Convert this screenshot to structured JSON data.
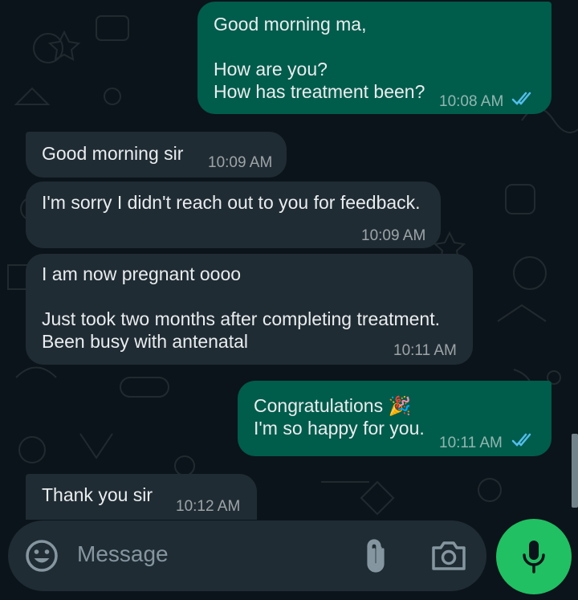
{
  "messages": [
    {
      "dir": "out",
      "text": "Good morning ma,\n\nHow are you?\nHow has treatment been?",
      "time": "10:08 AM",
      "read": true
    },
    {
      "dir": "in",
      "text": "Good morning sir",
      "time": "10:09 AM"
    },
    {
      "dir": "in",
      "text": "I'm sorry I didn't reach out to you for feedback.",
      "time": "10:09 AM"
    },
    {
      "dir": "in",
      "text": "I am now pregnant oooo\n\nJust took two months after completing treatment.\nBeen busy with antenatal",
      "time": "10:11 AM"
    },
    {
      "dir": "out",
      "text": "Congratulations 🎉\nI'm so happy for you.",
      "time": "10:11 AM",
      "read": true
    },
    {
      "dir": "in",
      "text": "Thank you sir",
      "time": "10:12 AM"
    }
  ],
  "composer": {
    "placeholder": "Message",
    "emoji_icon": "emoji-icon",
    "attach_icon": "paperclip-icon",
    "camera_icon": "camera-icon",
    "mic_icon": "microphone-icon"
  },
  "colors": {
    "background": "#0b141a",
    "outgoing_bubble": "#005c4b",
    "incoming_bubble": "#202c33",
    "read_ticks": "#53bdeb",
    "mic_button": "#21c063"
  }
}
